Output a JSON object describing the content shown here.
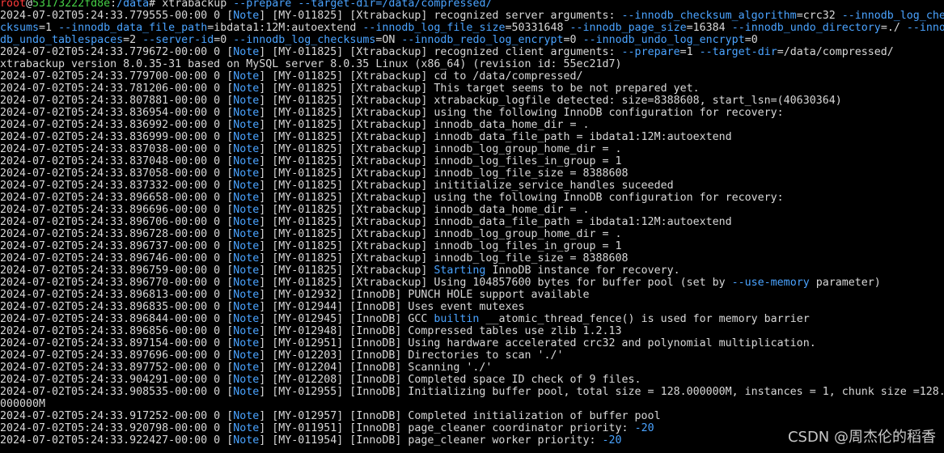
{
  "colors": {
    "background": "#000000",
    "text": "#d8d8d8",
    "accent_blue": "#4aa3ff",
    "prompt_user": "#ff3b3b",
    "prompt_host": "#46d046"
  },
  "prompt": {
    "user": "root",
    "at": "@",
    "host": "53173222fd8e",
    "colon": ":",
    "path": "/data",
    "symbol": "# ",
    "command": "xtrabackup",
    "args": "--prepare --target-dir=/data/compressed/"
  },
  "lines": [
    {
      "segments": [
        {
          "t": "2024-07-02T05:24:33.779555-00:00 0 [",
          "c": ""
        },
        {
          "t": "Note",
          "c": "blue"
        },
        {
          "t": "] [MY-011825] [Xtrabackup] recognized server arguments: ",
          "c": ""
        },
        {
          "t": "--innodb_checksum_algorithm",
          "c": "blue"
        },
        {
          "t": "=crc32 ",
          "c": ""
        },
        {
          "t": "--innodb_log_che",
          "c": "blue"
        }
      ]
    },
    {
      "segments": [
        {
          "t": "cksums",
          "c": "blue"
        },
        {
          "t": "=1 ",
          "c": ""
        },
        {
          "t": "--innodb_data_file_path",
          "c": "blue"
        },
        {
          "t": "=ibdata1:12M:autoextend ",
          "c": ""
        },
        {
          "t": "--innodb_log_file_size",
          "c": "blue"
        },
        {
          "t": "=50331648 ",
          "c": ""
        },
        {
          "t": "--innodb_page_size",
          "c": "blue"
        },
        {
          "t": "=16384 ",
          "c": ""
        },
        {
          "t": "--innodb_undo_directory",
          "c": "blue"
        },
        {
          "t": "=./ ",
          "c": ""
        },
        {
          "t": "--inno",
          "c": "blue"
        }
      ]
    },
    {
      "segments": [
        {
          "t": "db_undo_tablespaces",
          "c": "blue"
        },
        {
          "t": "=2 ",
          "c": ""
        },
        {
          "t": "--server-id",
          "c": "blue"
        },
        {
          "t": "=0 ",
          "c": ""
        },
        {
          "t": "--innodb_log_checksums",
          "c": "blue"
        },
        {
          "t": "=ON ",
          "c": ""
        },
        {
          "t": "--innodb_redo_log_encrypt",
          "c": "blue"
        },
        {
          "t": "=0 ",
          "c": ""
        },
        {
          "t": "--innodb_undo_log_encrypt",
          "c": "blue"
        },
        {
          "t": "=0",
          "c": ""
        }
      ]
    },
    {
      "segments": [
        {
          "t": "2024-07-02T05:24:33.779672-00:00 0 [",
          "c": ""
        },
        {
          "t": "Note",
          "c": "blue"
        },
        {
          "t": "] [MY-011825] [Xtrabackup] recognized client arguments: ",
          "c": ""
        },
        {
          "t": "--prepare",
          "c": "blue"
        },
        {
          "t": "=1 ",
          "c": ""
        },
        {
          "t": "--target-dir",
          "c": "blue"
        },
        {
          "t": "=/data/compressed/",
          "c": ""
        }
      ]
    },
    {
      "segments": [
        {
          "t": "xtrabackup version 8.0.35-31 based on MySQL server 8.0.35 Linux (x86_64) (revision id: 55ec21d7)",
          "c": ""
        }
      ]
    },
    {
      "segments": [
        {
          "t": "2024-07-02T05:24:33.779700-00:00 0 [",
          "c": ""
        },
        {
          "t": "Note",
          "c": "blue"
        },
        {
          "t": "] [MY-011825] [Xtrabackup] cd to /data/compressed/",
          "c": ""
        }
      ]
    },
    {
      "segments": [
        {
          "t": "2024-07-02T05:24:33.781206-00:00 0 [",
          "c": ""
        },
        {
          "t": "Note",
          "c": "blue"
        },
        {
          "t": "] [MY-011825] [Xtrabackup] This target seems to be not prepared yet.",
          "c": ""
        }
      ]
    },
    {
      "segments": [
        {
          "t": "2024-07-02T05:24:33.807881-00:00 0 [",
          "c": ""
        },
        {
          "t": "Note",
          "c": "blue"
        },
        {
          "t": "] [MY-011825] [Xtrabackup] xtrabackup_logfile detected: size=8388608, start_lsn=(40630364)",
          "c": ""
        }
      ]
    },
    {
      "segments": [
        {
          "t": "2024-07-02T05:24:33.836954-00:00 0 [",
          "c": ""
        },
        {
          "t": "Note",
          "c": "blue"
        },
        {
          "t": "] [MY-011825] [Xtrabackup] using the following InnoDB configuration for recovery:",
          "c": ""
        }
      ]
    },
    {
      "segments": [
        {
          "t": "2024-07-02T05:24:33.836992-00:00 0 [",
          "c": ""
        },
        {
          "t": "Note",
          "c": "blue"
        },
        {
          "t": "] [MY-011825] [Xtrabackup] innodb_data_home_dir = .",
          "c": ""
        }
      ]
    },
    {
      "segments": [
        {
          "t": "2024-07-02T05:24:33.836999-00:00 0 [",
          "c": ""
        },
        {
          "t": "Note",
          "c": "blue"
        },
        {
          "t": "] [MY-011825] [Xtrabackup] innodb_data_file_path = ibdata1:12M:autoextend",
          "c": ""
        }
      ]
    },
    {
      "segments": [
        {
          "t": "2024-07-02T05:24:33.837038-00:00 0 [",
          "c": ""
        },
        {
          "t": "Note",
          "c": "blue"
        },
        {
          "t": "] [MY-011825] [Xtrabackup] innodb_log_group_home_dir = .",
          "c": ""
        }
      ]
    },
    {
      "segments": [
        {
          "t": "2024-07-02T05:24:33.837048-00:00 0 [",
          "c": ""
        },
        {
          "t": "Note",
          "c": "blue"
        },
        {
          "t": "] [MY-011825] [Xtrabackup] innodb_log_files_in_group = 1",
          "c": ""
        }
      ]
    },
    {
      "segments": [
        {
          "t": "2024-07-02T05:24:33.837058-00:00 0 [",
          "c": ""
        },
        {
          "t": "Note",
          "c": "blue"
        },
        {
          "t": "] [MY-011825] [Xtrabackup] innodb_log_file_size = 8388608",
          "c": ""
        }
      ]
    },
    {
      "segments": [
        {
          "t": "2024-07-02T05:24:33.837332-00:00 0 [",
          "c": ""
        },
        {
          "t": "Note",
          "c": "blue"
        },
        {
          "t": "] [MY-011825] [Xtrabackup] inititialize_service_handles suceeded",
          "c": ""
        }
      ]
    },
    {
      "segments": [
        {
          "t": "2024-07-02T05:24:33.896658-00:00 0 [",
          "c": ""
        },
        {
          "t": "Note",
          "c": "blue"
        },
        {
          "t": "] [MY-011825] [Xtrabackup] using the following InnoDB configuration for recovery:",
          "c": ""
        }
      ]
    },
    {
      "segments": [
        {
          "t": "2024-07-02T05:24:33.896696-00:00 0 [",
          "c": ""
        },
        {
          "t": "Note",
          "c": "blue"
        },
        {
          "t": "] [MY-011825] [Xtrabackup] innodb_data_home_dir = .",
          "c": ""
        }
      ]
    },
    {
      "segments": [
        {
          "t": "2024-07-02T05:24:33.896706-00:00 0 [",
          "c": ""
        },
        {
          "t": "Note",
          "c": "blue"
        },
        {
          "t": "] [MY-011825] [Xtrabackup] innodb_data_file_path = ibdata1:12M:autoextend",
          "c": ""
        }
      ]
    },
    {
      "segments": [
        {
          "t": "2024-07-02T05:24:33.896728-00:00 0 [",
          "c": ""
        },
        {
          "t": "Note",
          "c": "blue"
        },
        {
          "t": "] [MY-011825] [Xtrabackup] innodb_log_group_home_dir = .",
          "c": ""
        }
      ]
    },
    {
      "segments": [
        {
          "t": "2024-07-02T05:24:33.896737-00:00 0 [",
          "c": ""
        },
        {
          "t": "Note",
          "c": "blue"
        },
        {
          "t": "] [MY-011825] [Xtrabackup] innodb_log_files_in_group = 1",
          "c": ""
        }
      ]
    },
    {
      "segments": [
        {
          "t": "2024-07-02T05:24:33.896746-00:00 0 [",
          "c": ""
        },
        {
          "t": "Note",
          "c": "blue"
        },
        {
          "t": "] [MY-011825] [Xtrabackup] innodb_log_file_size = 8388608",
          "c": ""
        }
      ]
    },
    {
      "segments": [
        {
          "t": "2024-07-02T05:24:33.896759-00:00 0 [",
          "c": ""
        },
        {
          "t": "Note",
          "c": "blue"
        },
        {
          "t": "] [MY-011825] [Xtrabackup] ",
          "c": ""
        },
        {
          "t": "Starting",
          "c": "blue"
        },
        {
          "t": " InnoDB instance for recovery.",
          "c": ""
        }
      ]
    },
    {
      "segments": [
        {
          "t": "2024-07-02T05:24:33.896770-00:00 0 [",
          "c": ""
        },
        {
          "t": "Note",
          "c": "blue"
        },
        {
          "t": "] [MY-011825] [Xtrabackup] Using 104857600 bytes for buffer pool (set by ",
          "c": ""
        },
        {
          "t": "--use-memory",
          "c": "blue"
        },
        {
          "t": " parameter)",
          "c": ""
        }
      ]
    },
    {
      "segments": [
        {
          "t": "2024-07-02T05:24:33.896813-00:00 0 [",
          "c": ""
        },
        {
          "t": "Note",
          "c": "blue"
        },
        {
          "t": "] [MY-012932] [InnoDB] PUNCH HOLE support available",
          "c": ""
        }
      ]
    },
    {
      "segments": [
        {
          "t": "2024-07-02T05:24:33.896835-00:00 0 [",
          "c": ""
        },
        {
          "t": "Note",
          "c": "blue"
        },
        {
          "t": "] [MY-012944] [InnoDB] Uses event mutexes",
          "c": ""
        }
      ]
    },
    {
      "segments": [
        {
          "t": "2024-07-02T05:24:33.896844-00:00 0 [",
          "c": ""
        },
        {
          "t": "Note",
          "c": "blue"
        },
        {
          "t": "] [MY-012945] [InnoDB] GCC ",
          "c": ""
        },
        {
          "t": "builtin",
          "c": "blue"
        },
        {
          "t": " __atomic_thread_fence() is used for memory barrier",
          "c": ""
        }
      ]
    },
    {
      "segments": [
        {
          "t": "2024-07-02T05:24:33.896856-00:00 0 [",
          "c": ""
        },
        {
          "t": "Note",
          "c": "blue"
        },
        {
          "t": "] [MY-012948] [InnoDB] Compressed tables use zlib 1.2.13",
          "c": ""
        }
      ]
    },
    {
      "segments": [
        {
          "t": "2024-07-02T05:24:33.897154-00:00 0 [",
          "c": ""
        },
        {
          "t": "Note",
          "c": "blue"
        },
        {
          "t": "] [MY-012951] [InnoDB] Using hardware accelerated crc32 and polynomial multiplication.",
          "c": ""
        }
      ]
    },
    {
      "segments": [
        {
          "t": "2024-07-02T05:24:33.897696-00:00 0 [",
          "c": ""
        },
        {
          "t": "Note",
          "c": "blue"
        },
        {
          "t": "] [MY-012203] [InnoDB] Directories to scan './'",
          "c": ""
        }
      ]
    },
    {
      "segments": [
        {
          "t": "2024-07-02T05:24:33.897752-00:00 0 [",
          "c": ""
        },
        {
          "t": "Note",
          "c": "blue"
        },
        {
          "t": "] [MY-012204] [InnoDB] Scanning './'",
          "c": ""
        }
      ]
    },
    {
      "segments": [
        {
          "t": "2024-07-02T05:24:33.904291-00:00 0 [",
          "c": ""
        },
        {
          "t": "Note",
          "c": "blue"
        },
        {
          "t": "] [MY-012208] [InnoDB] Completed space ID check of 9 files.",
          "c": ""
        }
      ]
    },
    {
      "segments": [
        {
          "t": "2024-07-02T05:24:33.908535-00:00 0 [",
          "c": ""
        },
        {
          "t": "Note",
          "c": "blue"
        },
        {
          "t": "] [MY-012955] [InnoDB] Initializing buffer pool, total size = 128.000000M, instances = 1, chunk size =128.",
          "c": ""
        }
      ]
    },
    {
      "segments": [
        {
          "t": "000000M",
          "c": ""
        }
      ]
    },
    {
      "segments": [
        {
          "t": "2024-07-02T05:24:33.917252-00:00 0 [",
          "c": ""
        },
        {
          "t": "Note",
          "c": "blue"
        },
        {
          "t": "] [MY-012957] [InnoDB] Completed initialization of buffer pool",
          "c": ""
        }
      ]
    },
    {
      "segments": [
        {
          "t": "2024-07-02T05:24:33.920798-00:00 0 [",
          "c": ""
        },
        {
          "t": "Note",
          "c": "blue"
        },
        {
          "t": "] [MY-011951] [InnoDB] page_cleaner coordinator priority: ",
          "c": ""
        },
        {
          "t": "-20",
          "c": "blue"
        }
      ]
    },
    {
      "segments": [
        {
          "t": "2024-07-02T05:24:33.922427-00:00 0 [",
          "c": ""
        },
        {
          "t": "Note",
          "c": "blue"
        },
        {
          "t": "] [MY-011954] [InnoDB] page_cleaner worker priority: ",
          "c": ""
        },
        {
          "t": "-20",
          "c": "blue"
        }
      ]
    }
  ],
  "watermark": "CSDN @周杰伦的稻香"
}
